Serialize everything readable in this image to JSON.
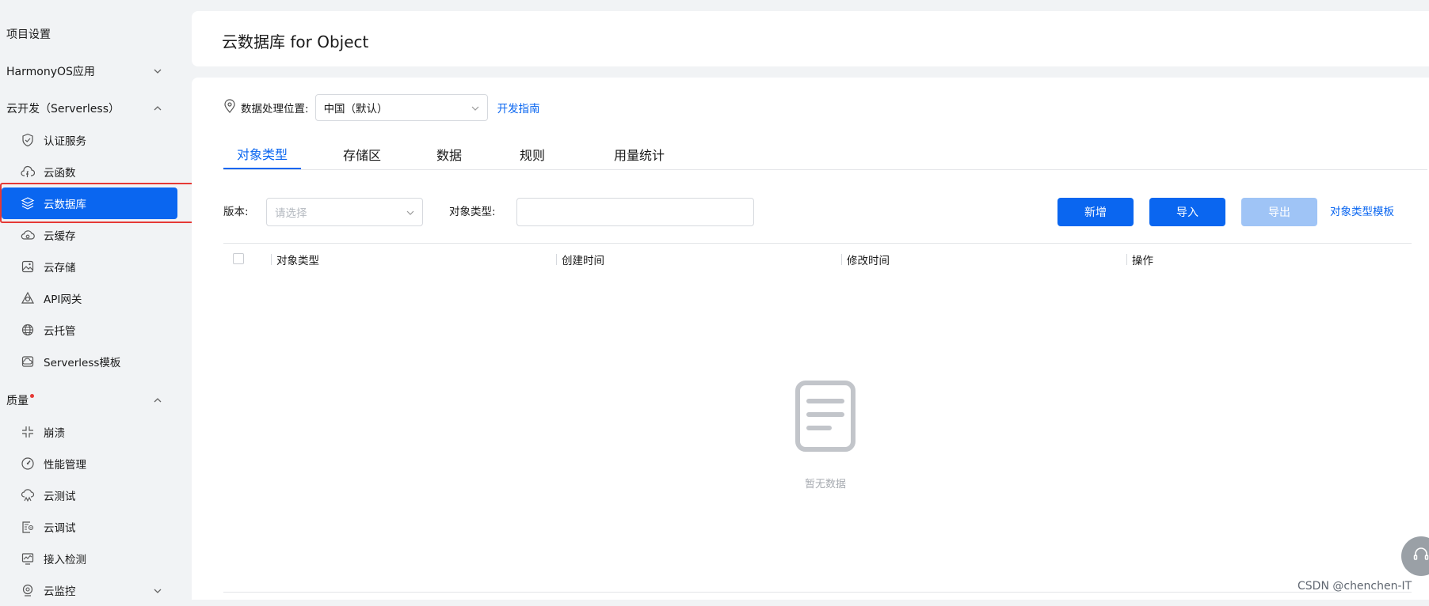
{
  "sidebar": {
    "project_settings": "项目设置",
    "harmony": "HarmonyOS应用",
    "cloud_dev": "云开发（Serverless）",
    "cloud_items": [
      "认证服务",
      "云函数",
      "云数据库",
      "云缓存",
      "云存储",
      "API网关",
      "云托管",
      "Serverless模板"
    ],
    "quality": "质量",
    "quality_items": [
      "崩溃",
      "性能管理",
      "云测试",
      "云调试",
      "接入检测",
      "云监控"
    ]
  },
  "header": {
    "title": "云数据库 for Object"
  },
  "location": {
    "label": "数据处理位置:",
    "value": "中国（默认）",
    "guide": "开发指南"
  },
  "tabs": [
    "对象类型",
    "存储区",
    "数据",
    "规则",
    "用量统计"
  ],
  "filters": {
    "version_label": "版本:",
    "version_placeholder": "请选择",
    "type_label": "对象类型:"
  },
  "actions": {
    "add": "新增",
    "import": "导入",
    "export": "导出",
    "template": "对象类型模板"
  },
  "table": {
    "columns": [
      "对象类型",
      "创建时间",
      "修改时间",
      "操作"
    ],
    "empty": "暂无数据"
  },
  "watermark": "CSDN @chenchen-IT",
  "colors": {
    "accent": "#0a66f0",
    "highlight_frame": "#e53935"
  }
}
